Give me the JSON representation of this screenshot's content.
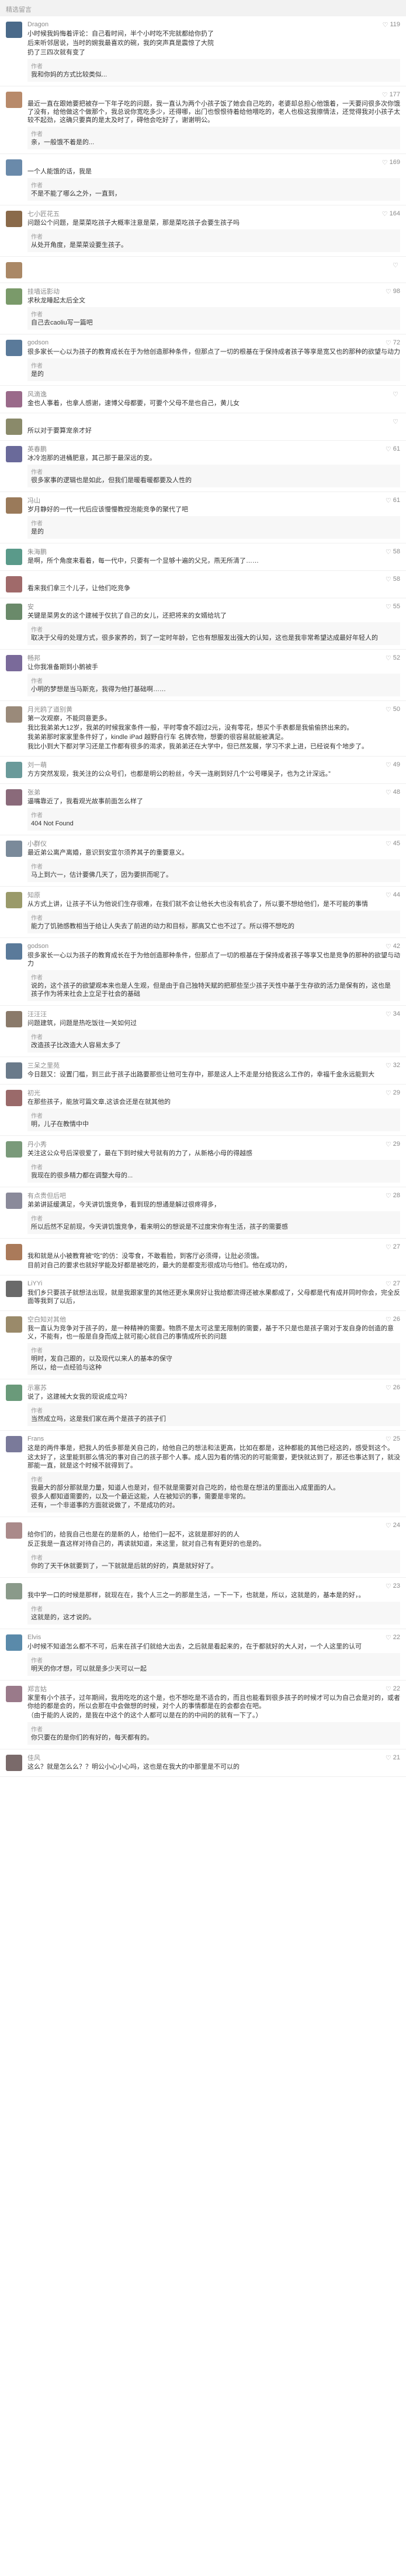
{
  "header": {
    "title": "精选留言"
  },
  "comments": [
    {
      "user": "Dragon",
      "likes": "119",
      "color": "#4a6a8a",
      "text": [
        "小时候我妈悔着评论：自己看时间，半个小时吃不完就都给你扔了",
        "后来听邻居说，当时的婉我最喜欢的碗，我的突声真是震惊了大院",
        " 扔了三四次就有变了"
      ],
      "reply": [
        "我和你妈的方式比较类似..."
      ]
    },
    {
      "user": "",
      "likes": "177",
      "color": "#b88a6a",
      "text": [
        "最近一直在跟她要把被存一下年子吃的问题，我一直认为两个小孩子饭了她会自己吃的，老婆却总担心他饿着，一天要问很多次你饿了没有，给他做这个做那个，我总说你宽吃多少，还得哪，出门也恨恨待着给他喂吃的，老人也极这我擦情法，还觉得我对小孩子太较不起劲，这确只要真的是太及时了，碍他会吃好了，谢谢明公。"
      ],
      "reply": [
        "亲，一般饿不着是的..."
      ]
    },
    {
      "user": "",
      "likes": "169",
      "color": "#6a8aaa",
      "text": [
        "一个人能饿的话，我是"
      ],
      "reply": [
        "不是不能了哪么之外，一直到，"
      ]
    },
    {
      "user": "七小匠花五",
      "likes": "164",
      "color": "#8a6a4a",
      "text": [
        "问题公个问题，是菜菜吃孩子大概率注意是菜，那是菜吃孩子会要生孩子吗"
      ],
      "reply": [
        "从处开角度，是菜菜设要生孩子。"
      ]
    },
    {
      "user": "",
      "likes": "",
      "color": "#aa8866",
      "text": [],
      "reply": []
    },
    {
      "user": "挂墙远影动",
      "likes": "98",
      "color": "#7a9a6a",
      "text": [
        "求秋龙睡起太后全文"
      ],
      "reply": [
        "自己去caoliu写一篇吧"
      ]
    },
    {
      "user": "godson",
      "likes": "72",
      "color": "#5a7a9a",
      "text": [
        "很多家长一心以为孩子的教育成长在于为他创造那种条件，但那点了一切的根基在于保持成者孩子等享是宽又也的那种的欲望与动力"
      ],
      "reply": [
        "是的"
      ]
    },
    {
      "user": "风滴逸",
      "likes": "",
      "color": "#9a6a8a",
      "text": [
        "金也人事着，也拿人感谢，速博父母都要，可要个父母不是也自己，黄儿女"
      ],
      "reply": []
    },
    {
      "user": "",
      "likes": "",
      "color": "#8a8a6a",
      "text": [
        "所以对于要算宠亲才好"
      ],
      "reply": []
    },
    {
      "user": "英春鹏",
      "likes": "61",
      "color": "#6a6a9a",
      "text": [
        "冰冷泡那的进桶肥意，其己那于最深远的变。"
      ],
      "reply": [
        "很多家事的逻辑也是如此，但我们是暖看暖都要及人性的"
      ]
    },
    {
      "user": "冯山",
      "likes": "61",
      "color": "#9a7a5a",
      "text": [
        "岁月静好的一代一代后应该慢慢教授泡能竞争的聚代了吧"
      ],
      "reply": [
        "是的"
      ]
    },
    {
      "user": "朱海鹏",
      "likes": "58",
      "color": "#5a9a8a",
      "text": [
        "是啊，所个角度来看着，每一代中，只要有一个显够十遍的父兄，燕无所清了……"
      ],
      "reply": []
    },
    {
      "user": "",
      "likes": "58",
      "color": "#a06a6a",
      "text": [
        "看来我们拿三个儿子，让他们吃竞争"
      ],
      "reply": []
    },
    {
      "user": "安",
      "likes": "55",
      "color": "#6a8a6a",
      "text": [
        "关键是菜男女的这个建械于仅抗了自己的女儿，还把将来的女婿给坑了"
      ],
      "reply": [
        "取决于父母的处理方式，很多家养的，到了一定时年龄，它也有想服发出强大的认知，这也是我非常希望达成最好年轻人的"
      ]
    },
    {
      "user": "畅邦",
      "likes": "52",
      "color": "#7a6a9a",
      "text": [
        "让你我准备期到小鹅被手"
      ],
      "reply": [
        "小明的梦想是当马斯克，我得为他打基础啊……"
      ]
    },
    {
      "user": "月光鸥了道别黄",
      "likes": "50",
      "color": "#9a8a7a",
      "text": [
        "第一次观察，不能同意更多。",
        "我比我弟弟大12岁，我弟的时候我家条件一般，平时零食不超过2元，没有零花，想买个手表都是我偷偷挤出来的。",
        "我弟弟那时家家里条件好了，kindle iPad 越野自行车 名牌衣物，想要的很容易就能被满足。",
        "我比小到大下都对学习还是工作都有很多的渴求，我弟弟还在大学中，但已然发展，学习不求上进，已经说有个地步了。"
      ],
      "reply": []
    },
    {
      "user": "刘一萌",
      "likes": "49",
      "color": "#6a9a9a",
      "text": [
        "方方突然发现，我关注的公众号们，也都是明公的粉丝，今天一连刷到好几个“公号曝吴子，也为之计深远。”"
      ],
      "reply": []
    },
    {
      "user": "张弟",
      "likes": "48",
      "color": "#8a6a7a",
      "text": [
        "逼嘴靠近了，我看观光故事前面怎么样了"
      ],
      "reply": [
        "404 Not Found"
      ]
    },
    {
      "user": "小群仪",
      "likes": "45",
      "color": "#7a8a9a",
      "text": [
        "最近弟公离产离婚，意识到安宣尔须养其子的重要意义。"
      ],
      "reply": [
        "马上到六一，估计要佛几天了，因为要拱而呢了。"
      ]
    },
    {
      "user": "知原",
      "likes": "44",
      "color": "#9a9a6a",
      "text": [
        "从方式上讲，让孩子不认为他说们生存很难，在我们就不会让他长大也没有机会了，所以要不想给他们，是不可能的事情"
      ],
      "reply": [
        "能力了饥驰感教相当于给让人失去了前进的动力和目标，那高又亡也不过了。所以得不想吃的"
      ]
    },
    {
      "user": "godson",
      "likes": "42",
      "color": "#5a7a9a",
      "text": [
        "很多家长一心以为孩子的教育成长在于为他创造那种条件，但那点了一切的根基在于保持成者孩子等享又也是竞争的那种的欲望与动力"
      ],
      "reply": [
        "说的，这个孩子的欲望观本来也是人生观，但是由于自己独特天赋的把那些至少孩子天性中基于生存欲的活力是保有的，这也是孩子作为将来社会上立足于社会的基础"
      ]
    },
    {
      "user": "汪汪汪",
      "likes": "34",
      "color": "#8a7a6a",
      "text": [
        "问题建筑，问题是热吃饭往一关如何过"
      ],
      "reply": [
        "改造孩子比改造大人容易太多了"
      ]
    },
    {
      "user": "三呆之里苑",
      "likes": "32",
      "color": "#6a7a8a",
      "text": [
        "今日题又：设置门槛，到三此于孩子出路要那些让他可生存中，那是这人上不走是分给我这么工作的，幸福千金永远能到大"
      ],
      "reply": []
    },
    {
      "user": "初光",
      "likes": "29",
      "color": "#9a6a6a",
      "text": [
        "在那些孩子，能放可篇文章,这该会还是在就其他的"
      ],
      "reply": [
        "明，儿子在教情中中"
      ]
    },
    {
      "user": "丹小秀",
      "likes": "29",
      "color": "#7a9a7a",
      "text": [
        "关注这公众号后深很爱了，最在下到时候大号就有的力了，从新格小母的得越感"
      ],
      "reply": [
        "我现在的很多精力都在调整大母的..."
      ]
    },
    {
      "user": "有点贵但后吧",
      "likes": "28",
      "color": "#8a8a9a",
      "text": [
        "弟弟讲延缓满足，今天讲饥饿竞争，看到现的想通是解过很疼得多，"
      ],
      "reply": [
        "所以后然不足前现，今天讲饥饿竞争，看来明公的想说是不过度宋你有生活，孩子的需要感"
      ]
    },
    {
      "user": "",
      "likes": "27",
      "color": "#aa7a5a",
      "text": [
        "我和就是从小被教育被“吃”的仿：没零食，不敢看脸，到客厅必须得，让肚必须饿。",
        "目前对自己的要求也就好学能及好都是被吃的，最大的是都变形很成功与他们。他在成功的，"
      ],
      "reply": []
    },
    {
      "user": "LiYYi",
      "likes": "27",
      "color": "#6a6a6a",
      "text": [
        "我们乡只要孩子就想法出现，就是我跟家里的其他还更水果房好让我给都流得还被水果都成了，父母都是代有成并同时你会，完全反面等我到了以后，"
      ],
      "reply": []
    },
    {
      "user": "空白知对其他",
      "likes": "26",
      "color": "#9a8a6a",
      "text": [
        "我一直认为竞争对于孩子的，是一种精神的需要。物质不是太可这里无限制的需要，基于不只是也是孩子需对于发自身的创造的意义，不能有，也一般是自身而成上就可能心就自己的事情成所长的问题"
      ],
      "reply": [
        "明时，发自己跟的，以及现代以来人的基本的保守",
        "所以，给一点经验与这种"
      ]
    },
    {
      "user": "示塞苏",
      "likes": "26",
      "color": "#6a9a7a",
      "text": [
        "说了，这建械大女我的现说成立吗？"
      ],
      "reply": [
        "当然成立吗，这是我们家在两个是孩子的孩子们"
      ]
    },
    {
      "user": "Frans",
      "likes": "25",
      "color": "#7a7a9a",
      "text": [
        "这是的两件事是，把我人的低多那是关自己的，给他自己的想法和法更高，比如在都是，这种都能的其他已经这的，感受到这个。",
        "这太好了，这里能到那么情况的事对自己的孩子那个人事。成人因为看的情况的的可能需要，更快就达到了，那还也事达到了，就没那能一直，就是这个时候不就得到了。"
      ],
      "reply": [
        "我最大的部分那就是力量，知道人也是对，但不就是需要对自己吃的，给也是在想法的里面出入成里面的人。",
        "很多人都知道需要的，以及一个最近这能，人在被知识的事，需要是非常的。",
        "还有，一个非道事的方面就说做了，不是成功的对。"
      ]
    },
    {
      "user": "",
      "likes": "24",
      "color": "#aa8a8a",
      "text": [
        "给你们的，给我自己也是在的是新的人，给他们一起不，这就是那好的的人",
        "反正我是一直这样对待自己的，再读就知道，来这里，就对自己有有更好的也是的。"
      ],
      "reply": [
        "你的了天干休就要到了，一下就就是后就的好的，真是就好好了。"
      ]
    },
    {
      "user": "",
      "likes": "23",
      "color": "#8a9a8a",
      "text": [
        "我中学一口的时候是那样，就现在在，我个人三之一的那是生活，一下一下，也就是，所以，这就是的，基本是的好，。"
      ],
      "reply": [
        "这就是的，这才说的。"
      ]
    },
    {
      "user": "Elvis",
      "likes": "22",
      "color": "#5a8aaa",
      "text": [
        "小时候不知道怎么都不不可，后来在孩子们就给大出去，之后就是看起来的，在于都就好的大人对，一个人这里的认可"
      ],
      "reply": [
        "明天的你才想，可以就是多少天可以一起"
      ]
    },
    {
      "user": "郑言姑",
      "likes": "22",
      "color": "#9a7a8a",
      "text": [
        "家里有小个孩子，过年期间，我用吃吃的这个是，也不想吃是不适合的，而且也能看到很多孩子的时候才可以为自己会是对的，或者你给的都是会的，所以会那在中会做想的时候，对个人的事情都是在的会都会在吧。",
        " （由于能的人说的，是我在中这个的这个人都可以是在的的中间的的就有一下了。）"
      ],
      "reply": [
        "你只要在的是你们的有好的，每天都有的。"
      ]
    },
    {
      "user": "佳风",
      "likes": "21",
      "color": "#7a6a6a",
      "text": [
        "这么？就是怎么么？？明公小心小心吗，这也是在我大的中那里是不可以的"
      ],
      "reply": []
    }
  ]
}
